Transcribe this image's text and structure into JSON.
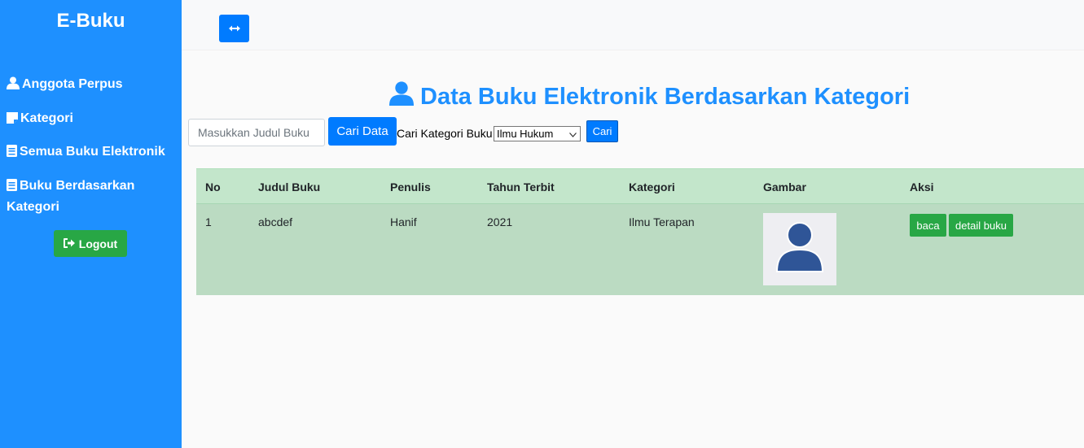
{
  "sidebar": {
    "brand": "E-Buku",
    "items": [
      {
        "label": "Anggota Perpus",
        "icon": "user-icon"
      },
      {
        "label": "Kategori",
        "icon": "sticky-note-icon"
      },
      {
        "label": "Semua Buku Elektronik",
        "icon": "book-icon"
      },
      {
        "label": "Buku Berdasarkan Kategori",
        "icon": "book-icon"
      }
    ],
    "logout_label": "Logout"
  },
  "topbar": {
    "toggle_icon": "arrows-horizontal-icon"
  },
  "main": {
    "title": "Data Buku Elektronik Berdasarkan Kategori",
    "search": {
      "placeholder": "Masukkan Judul Buku",
      "value": "",
      "button_label": "Cari Data"
    },
    "category_filter": {
      "label": "Cari Kategori Buku",
      "selected": "Ilmu Hukum",
      "button_label": "Cari"
    },
    "table": {
      "headers": [
        "No",
        "Judul Buku",
        "Penulis",
        "Tahun Terbit",
        "Kategori",
        "Gambar",
        "Aksi"
      ],
      "rows": [
        {
          "no": "1",
          "judul": "abcdef",
          "penulis": "Hanif",
          "tahun": "2021",
          "kategori": "Ilmu Terapan",
          "gambar_icon": "user-avatar-placeholder-icon",
          "actions": [
            "baca",
            "detail buku"
          ]
        }
      ]
    }
  },
  "colors": {
    "sidebar_bg": "#1e90ff",
    "primary": "#007bff",
    "success": "#28a745",
    "table_header_bg": "#c3e6cb",
    "table_row_bg": "#bbdbc2",
    "title_color": "#1e90ff"
  }
}
